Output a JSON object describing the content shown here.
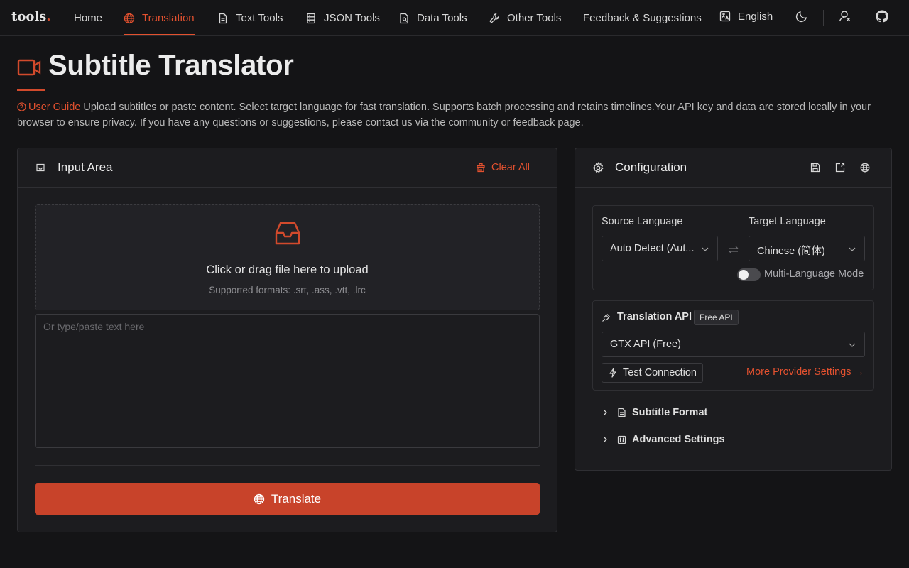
{
  "brand": {
    "name": "tools",
    "dot": "."
  },
  "nav": {
    "items": [
      {
        "label": "Home",
        "icon": "none"
      },
      {
        "label": "Translation",
        "icon": "globe-icon"
      },
      {
        "label": "Text Tools",
        "icon": "document-icon"
      },
      {
        "label": "JSON Tools",
        "icon": "server-icon"
      },
      {
        "label": "Data Tools",
        "icon": "data-file-icon"
      },
      {
        "label": "Other Tools",
        "icon": "wrench-icon"
      },
      {
        "label": "Feedback & Suggestions",
        "icon": "none"
      }
    ],
    "active_index": 1,
    "language": "English"
  },
  "page": {
    "title": "Subtitle Translator",
    "guide_link": "User Guide",
    "intro": "Upload subtitles or paste content. Select target language for fast translation. Supports batch processing and retains timelines.Your API key and data are stored locally in your browser to ensure privacy. If you have any questions or suggestions, please contact us via the community or feedback page."
  },
  "input": {
    "title": "Input Area",
    "clear_all": "Clear All",
    "upload_text": "Click or drag file here to upload",
    "upload_formats": "Supported formats: .srt, .ass, .vtt, .lrc",
    "placeholder": "Or type/paste text here",
    "translate": "Translate"
  },
  "config": {
    "title": "Configuration",
    "source_label": "Source Language",
    "source_value": "Auto Detect (Aut...",
    "target_label": "Target Language",
    "target_value": "Chinese (简体)",
    "multi_language": "Multi-Language Mode",
    "api_label": "Translation API",
    "api_badge": "Free API",
    "api_value": "GTX API (Free)",
    "test_connection": "Test Connection",
    "provider_link": "More Provider Settings →",
    "subtitle_format": "Subtitle Format",
    "advanced": "Advanced Settings"
  },
  "colors": {
    "accent": "#e3512f",
    "button": "#c8432a",
    "background": "#141416",
    "panel": "#1c1c1f"
  }
}
